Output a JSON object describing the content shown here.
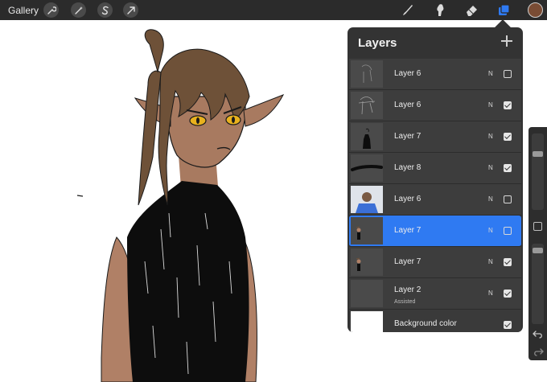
{
  "toolbar": {
    "gallery_label": "Gallery",
    "left_tools": [
      "actions-wrench-icon",
      "adjustments-wand-icon",
      "selection-s-icon",
      "transform-arrow-icon"
    ],
    "right_tools": [
      "brush-icon",
      "smudge-icon",
      "eraser-icon",
      "layers-icon"
    ],
    "active_tool": "layers-icon",
    "current_color": "#7a4c34",
    "accent_color": "#2f7af2"
  },
  "layers_panel": {
    "title": "Layers",
    "add_icon": "plus-icon",
    "layers": [
      {
        "name": "Layer 6",
        "sub": "",
        "blend": "N",
        "visible": false,
        "selected": false,
        "thumb": "sketch-light"
      },
      {
        "name": "Layer 6",
        "sub": "",
        "blend": "N",
        "visible": true,
        "selected": false,
        "thumb": "sketch"
      },
      {
        "name": "Layer 7",
        "sub": "",
        "blend": "N",
        "visible": true,
        "selected": false,
        "thumb": "figure-black"
      },
      {
        "name": "Layer 8",
        "sub": "",
        "blend": "N",
        "visible": true,
        "selected": false,
        "thumb": "black-stroke"
      },
      {
        "name": "Layer 6",
        "sub": "",
        "blend": "N",
        "visible": false,
        "selected": false,
        "thumb": "color-ref"
      },
      {
        "name": "Layer 7",
        "sub": "",
        "blend": "N",
        "visible": false,
        "selected": true,
        "thumb": "figure-small"
      },
      {
        "name": "Layer 7",
        "sub": "",
        "blend": "N",
        "visible": true,
        "selected": false,
        "thumb": "figure-small"
      },
      {
        "name": "Layer 2",
        "sub": "Assisted",
        "blend": "N",
        "visible": true,
        "selected": false,
        "thumb": "empty"
      }
    ],
    "background": {
      "name": "Background color",
      "visible": true,
      "color": "#ffffff"
    }
  },
  "sidebar": {
    "brush_size_level": 0.25,
    "opacity_level": 0.05,
    "modify_icon": "square-modify-icon",
    "undo_icon": "undo-icon",
    "redo_icon": "redo-icon"
  }
}
